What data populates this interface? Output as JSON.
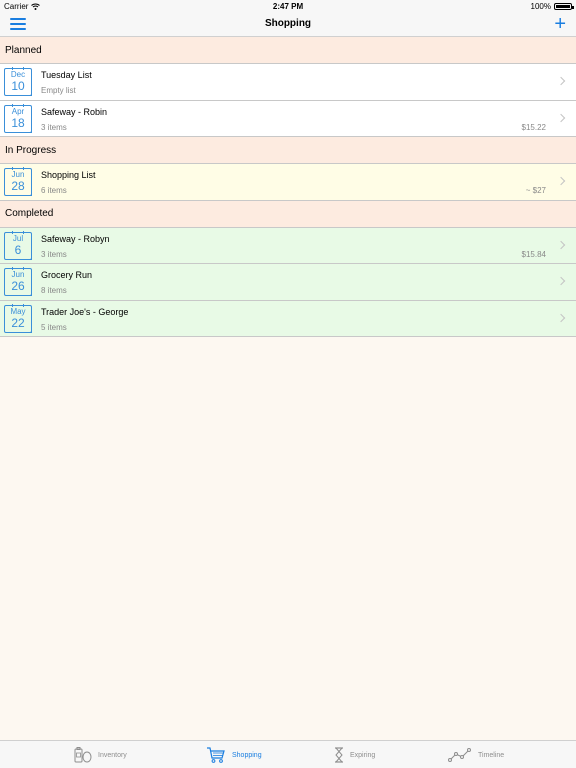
{
  "status": {
    "carrier": "Carrier",
    "time": "2:47 PM",
    "battery": "100%"
  },
  "nav": {
    "title": "Shopping",
    "add_label": "+"
  },
  "sections": [
    {
      "title": "Planned",
      "style": "planned",
      "lists": [
        {
          "month": "Dec",
          "day": "10",
          "name": "Tuesday List",
          "sub": "Empty list",
          "price": ""
        },
        {
          "month": "Apr",
          "day": "18",
          "name": "Safeway - Robin",
          "sub": "3 items",
          "price": "$15.22"
        }
      ]
    },
    {
      "title": "In Progress",
      "style": "progress",
      "lists": [
        {
          "month": "Jun",
          "day": "28",
          "name": "Shopping List",
          "sub": "6 items",
          "price": "~ $27"
        }
      ]
    },
    {
      "title": "Completed",
      "style": "completed",
      "lists": [
        {
          "month": "Jul",
          "day": "6",
          "name": "Safeway - Robyn",
          "sub": "3 items",
          "price": "$15.84"
        },
        {
          "month": "Jun",
          "day": "26",
          "name": "Grocery Run",
          "sub": "8 items",
          "price": ""
        },
        {
          "month": "May",
          "day": "22",
          "name": "Trader Joe's - George",
          "sub": "5 items",
          "price": ""
        }
      ]
    }
  ],
  "tabs": [
    {
      "label": "Inventory",
      "icon": "inventory-icon",
      "active": false
    },
    {
      "label": "Shopping",
      "icon": "cart-icon",
      "active": true
    },
    {
      "label": "Expiring",
      "icon": "hourglass-icon",
      "active": false
    },
    {
      "label": "Timeline",
      "icon": "timeline-icon",
      "active": false
    }
  ],
  "colors": {
    "accent": "#1a7ee0",
    "planned": "#ffffff",
    "progress": "#fffde6",
    "completed": "#e8fae6",
    "header": "#fdebe0"
  }
}
